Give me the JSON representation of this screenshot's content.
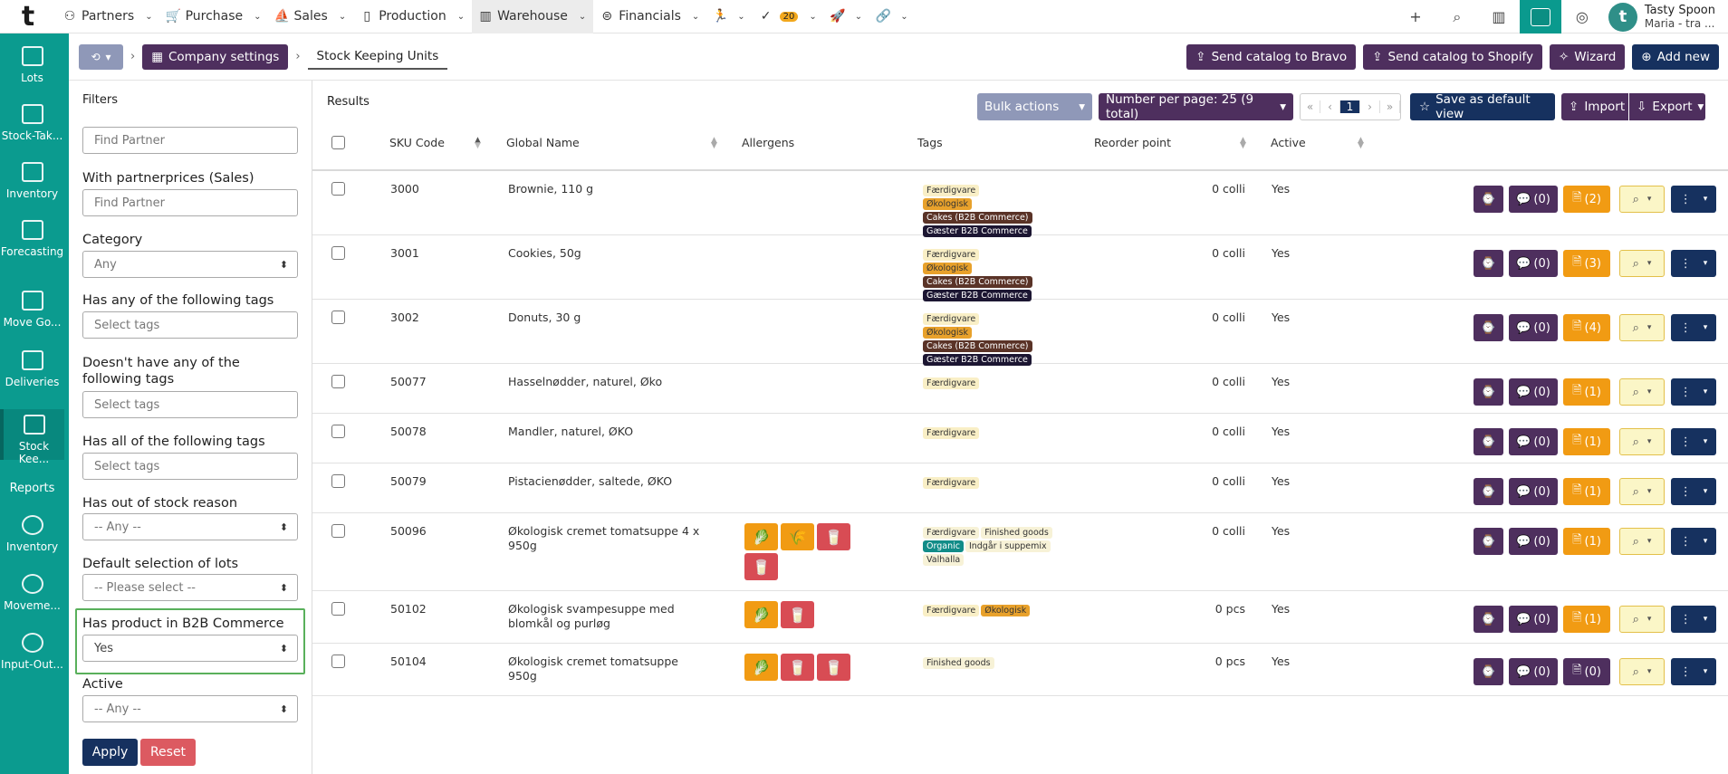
{
  "app": {
    "logo": "t"
  },
  "topnav": {
    "items": [
      {
        "label": "Partners",
        "icon": "partners-icon"
      },
      {
        "label": "Purchase",
        "icon": "cart-icon"
      },
      {
        "label": "Sales",
        "icon": "sales-icon"
      },
      {
        "label": "Production",
        "icon": "production-icon"
      },
      {
        "label": "Warehouse",
        "icon": "warehouse-icon"
      },
      {
        "label": "Financials",
        "icon": "financials-icon"
      }
    ],
    "tasks_badge": "20",
    "user": {
      "name": "Tasty Spoon",
      "sub": "Maria - tra ...",
      "avatar": "t"
    }
  },
  "sidebar": {
    "items": [
      {
        "label": "Lots"
      },
      {
        "label": "Stock-Tak..."
      },
      {
        "label": "Inventory"
      },
      {
        "label": "Forecasting"
      },
      {
        "label": "Move Go..."
      },
      {
        "label": "Deliveries"
      },
      {
        "label": "Stock Kee..."
      }
    ],
    "reports_heading": "Reports",
    "reports": [
      {
        "label": "Inventory"
      },
      {
        "label": "Moveme..."
      },
      {
        "label": "Input-Out..."
      }
    ]
  },
  "breadcrumb": {
    "company": "Company settings",
    "current": "Stock Keeping Units"
  },
  "actions": {
    "send_bravo": "Send catalog to Bravo",
    "send_shopify": "Send catalog to Shopify",
    "wizard": "Wizard",
    "add_new": "Add new"
  },
  "filters": {
    "title": "Filters",
    "partner_placeholder": "Find Partner",
    "partnerprices_label": "With partnerprices (Sales)",
    "partnerprices_placeholder": "Find Partner",
    "category_label": "Category",
    "category_value": "Any",
    "has_any_tags_label": "Has any of the following tags",
    "has_any_tags_placeholder": "Select tags",
    "not_tags_label": "Doesn't have any of the following tags",
    "not_tags_placeholder": "Select tags",
    "all_tags_label": "Has all of the following tags",
    "all_tags_placeholder": "Select tags",
    "oos_label": "Has out of stock reason",
    "oos_value": "-- Any --",
    "lots_label": "Default selection of lots",
    "lots_value": "-- Please select --",
    "b2b_label": "Has product in B2B Commerce",
    "b2b_value": "Yes",
    "active_label": "Active",
    "active_value": "-- Any --",
    "apply": "Apply",
    "reset": "Reset"
  },
  "results": {
    "title": "Results",
    "bulk_actions": "Bulk actions",
    "per_page": "Number per page: 25 (9 total)",
    "pager": [
      "«",
      "‹",
      "1",
      "›",
      "»"
    ],
    "save_default": "Save as default view",
    "import": "Import",
    "export": "Export",
    "columns": [
      "SKU Code",
      "Global Name",
      "Allergens",
      "Tags",
      "Reorder point",
      "Active"
    ],
    "rows": [
      {
        "sku": "3000",
        "name": "Brownie, 110 g",
        "allergens": [],
        "tags": [
          [
            "Færdigvare",
            "f"
          ],
          [
            "Økologisk",
            "o"
          ],
          [
            "Cakes (B2B Commerce)",
            "c"
          ],
          [
            "Gæster B2B Commerce",
            "g"
          ]
        ],
        "reorder": "0 colli",
        "active": "Yes",
        "comments": "(0)",
        "docs": "(2)"
      },
      {
        "sku": "3001",
        "name": "Cookies, 50g",
        "allergens": [],
        "tags": [
          [
            "Færdigvare",
            "f"
          ],
          [
            "Økologisk",
            "o"
          ],
          [
            "Cakes (B2B Commerce)",
            "c"
          ],
          [
            "Gæster B2B Commerce",
            "g"
          ]
        ],
        "reorder": "0 colli",
        "active": "Yes",
        "comments": "(0)",
        "docs": "(3)"
      },
      {
        "sku": "3002",
        "name": "Donuts, 30 g",
        "allergens": [],
        "tags": [
          [
            "Færdigvare",
            "f"
          ],
          [
            "Økologisk",
            "o"
          ],
          [
            "Cakes (B2B Commerce)",
            "c"
          ],
          [
            "Gæster B2B Commerce",
            "g"
          ]
        ],
        "reorder": "0 colli",
        "active": "Yes",
        "comments": "(0)",
        "docs": "(4)"
      },
      {
        "sku": "50077",
        "name": "Hasselnødder, naturel, Øko",
        "allergens": [],
        "tags": [
          [
            "Færdigvare",
            "f"
          ]
        ],
        "reorder": "0 colli",
        "active": "Yes",
        "comments": "(0)",
        "docs": "(1)"
      },
      {
        "sku": "50078",
        "name": "Mandler, naturel, ØKO",
        "allergens": [],
        "tags": [
          [
            "Færdigvare",
            "f"
          ]
        ],
        "reorder": "0 colli",
        "active": "Yes",
        "comments": "(0)",
        "docs": "(1)"
      },
      {
        "sku": "50079",
        "name": "Pistacienødder, saltede, ØKO",
        "allergens": [],
        "tags": [
          [
            "Færdigvare",
            "f"
          ]
        ],
        "reorder": "0 colli",
        "active": "Yes",
        "comments": "(0)",
        "docs": "(1)"
      },
      {
        "sku": "50096",
        "name": "Økologisk cremet tomatsuppe 4 x 950g",
        "allergens": [
          "celery",
          "wheat",
          "milk",
          "milk"
        ],
        "tags": [
          [
            "Færdigvare",
            "fg"
          ],
          [
            "Finished goods",
            "fg"
          ],
          [
            "Organic",
            "org"
          ],
          [
            "Indgår i suppemix",
            "i"
          ],
          [
            "Valhalla",
            "v"
          ]
        ],
        "reorder": "0 colli",
        "active": "Yes",
        "comments": "(0)",
        "docs": "(1)"
      },
      {
        "sku": "50102",
        "name": "Økologisk svampesuppe med blomkål og purløg",
        "allergens": [
          "celery",
          "milk"
        ],
        "tags": [
          [
            "Færdigvare",
            "f"
          ],
          [
            "Økologisk",
            "o"
          ]
        ],
        "reorder": "0 pcs",
        "active": "Yes",
        "comments": "(0)",
        "docs": "(1)"
      },
      {
        "sku": "50104",
        "name": "Økologisk cremet tomatsuppe 950g",
        "allergens": [
          "celery",
          "milk",
          "milk"
        ],
        "tags": [
          [
            "Finished goods",
            "fg"
          ]
        ],
        "reorder": "0 pcs",
        "active": "Yes",
        "comments": "(0)",
        "docs": "(0)"
      }
    ]
  }
}
